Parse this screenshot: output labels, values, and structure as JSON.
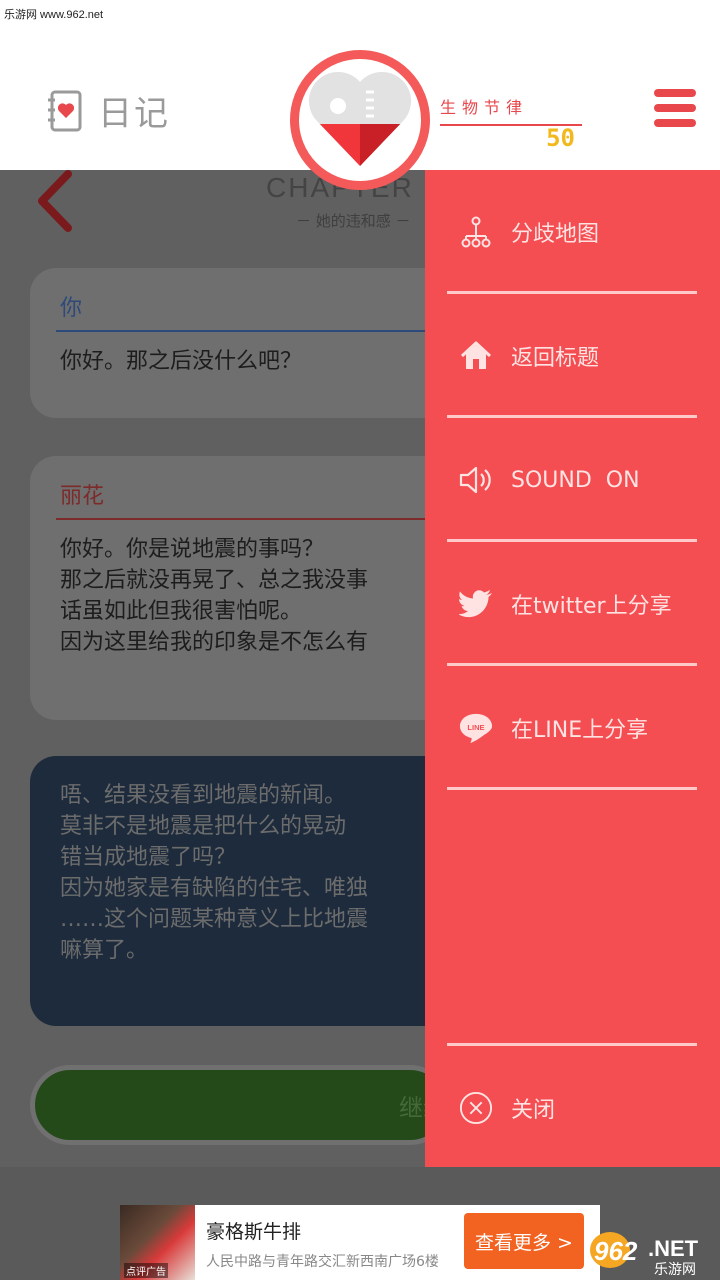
{
  "watermark": "乐游网 www.962.net",
  "header": {
    "diary_title": "日记",
    "biorhythm_label": "生物节律",
    "biorhythm_value": "50"
  },
  "chapter": {
    "title": "CHAPTER",
    "subtitle": "－ 她的违和感 －"
  },
  "dialogue": [
    {
      "speaker": "你",
      "text": "你好。那之后没什么吧？"
    },
    {
      "speaker": "丽花",
      "text": "你好。你是说地震的事吗？\n那之后就没再晃了、总之我没事\n话虽如此但我很害怕呢。\n因为这里给我的印象是不怎么有"
    }
  ],
  "narration": "唔、结果没看到地震的新闻。\n莫非不是地震是把什么的晃动\n错当成地震了吗？\n因为她家是有缺陷的住宅、唯独\n……这个问题某种意义上比地震\n嘛算了。",
  "continue_label": "继续",
  "side_menu": {
    "items": [
      {
        "icon": "branch-map-icon",
        "label": "分歧地图"
      },
      {
        "icon": "home-icon",
        "label": "返回标题"
      },
      {
        "icon": "speaker-icon",
        "label": "SOUND  ON"
      },
      {
        "icon": "twitter-icon",
        "label": "在twitter上分享"
      },
      {
        "icon": "line-icon",
        "label": "在LINE上分享",
        "icon_text": "LINE"
      }
    ],
    "close_label": "关闭"
  },
  "ad": {
    "image_label": "点评广告",
    "title": "豪格斯牛排",
    "description": "人民中路与青年路交汇新西南广场6楼",
    "button_label": "查看更多 >"
  },
  "site_logo": {
    "number": "962",
    "suffix": ".NET",
    "name": "乐游网"
  },
  "colors": {
    "accent": "#f44e52",
    "biorhythm_value": "#f2b91f",
    "ad_button": "#f26322"
  }
}
